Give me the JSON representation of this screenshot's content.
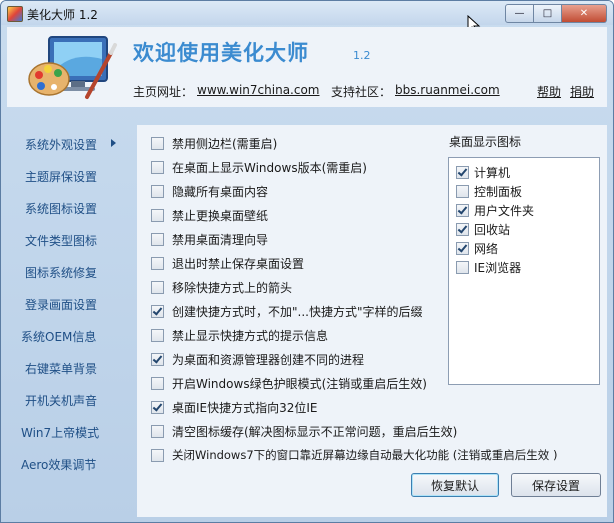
{
  "window": {
    "title": "美化大师 1.2",
    "buttons": {
      "minimize": "—",
      "maximize": "□",
      "close": "✕"
    }
  },
  "header": {
    "welcome": "欢迎使用美化大师",
    "version": "1.2",
    "homepage_label": "主页网址：",
    "homepage_url": "www.win7china.com",
    "community_label": "支持社区：",
    "community_url": "bbs.ruanmei.com",
    "help": "帮助",
    "donate": "捐助"
  },
  "sidebar": {
    "items": [
      "系统外观设置",
      "主题屏保设置",
      "系统图标设置",
      "文件类型图标",
      "图标系统修复",
      "登录画面设置",
      "系统OEM信息",
      "右键菜单背景",
      "开机关机声音",
      "Win7上帝模式",
      "Aero效果调节"
    ],
    "selected_index": 0
  },
  "options": [
    {
      "label": "禁用侧边栏(需重启)",
      "checked": false
    },
    {
      "label": "在桌面上显示Windows版本(需重启)",
      "checked": false
    },
    {
      "label": "隐藏所有桌面内容",
      "checked": false
    },
    {
      "label": "禁止更换桌面壁纸",
      "checked": false
    },
    {
      "label": "禁用桌面清理向导",
      "checked": false
    },
    {
      "label": "退出时禁止保存桌面设置",
      "checked": false
    },
    {
      "label": "移除快捷方式上的箭头",
      "checked": false
    },
    {
      "label": "创建快捷方式时，不加\"...快捷方式\"字样的后缀",
      "checked": true
    },
    {
      "label": "禁止显示快捷方式的提示信息",
      "checked": false
    },
    {
      "label": "为桌面和资源管理器创建不同的进程",
      "checked": true
    },
    {
      "label": "开启Windows绿色护眼模式(注销或重启后生效)",
      "checked": false
    },
    {
      "label": "桌面IE快捷方式指向32位IE",
      "checked": true
    },
    {
      "label": "清空图标缓存(解决图标显示不正常问题，重启后生效)",
      "checked": false
    },
    {
      "label": "关闭Windows7下的窗口靠近屏幕边缘自动最大化功能 (注销或重启后生效 )",
      "checked": false
    }
  ],
  "desktop_icons": {
    "title": "桌面显示图标",
    "items": [
      {
        "label": "计算机",
        "checked": true
      },
      {
        "label": "控制面板",
        "checked": false
      },
      {
        "label": "用户文件夹",
        "checked": true
      },
      {
        "label": "回收站",
        "checked": true
      },
      {
        "label": "网络",
        "checked": true
      },
      {
        "label": "IE浏览器",
        "checked": false
      }
    ]
  },
  "actions": {
    "restore": "恢复默认",
    "save": "保存设置"
  },
  "colors": {
    "accent": "#3b8bd0",
    "sidebar_text": "#1f4f86",
    "panel_bg": "#eef3f9",
    "frame_bg": "#c9dcef"
  }
}
